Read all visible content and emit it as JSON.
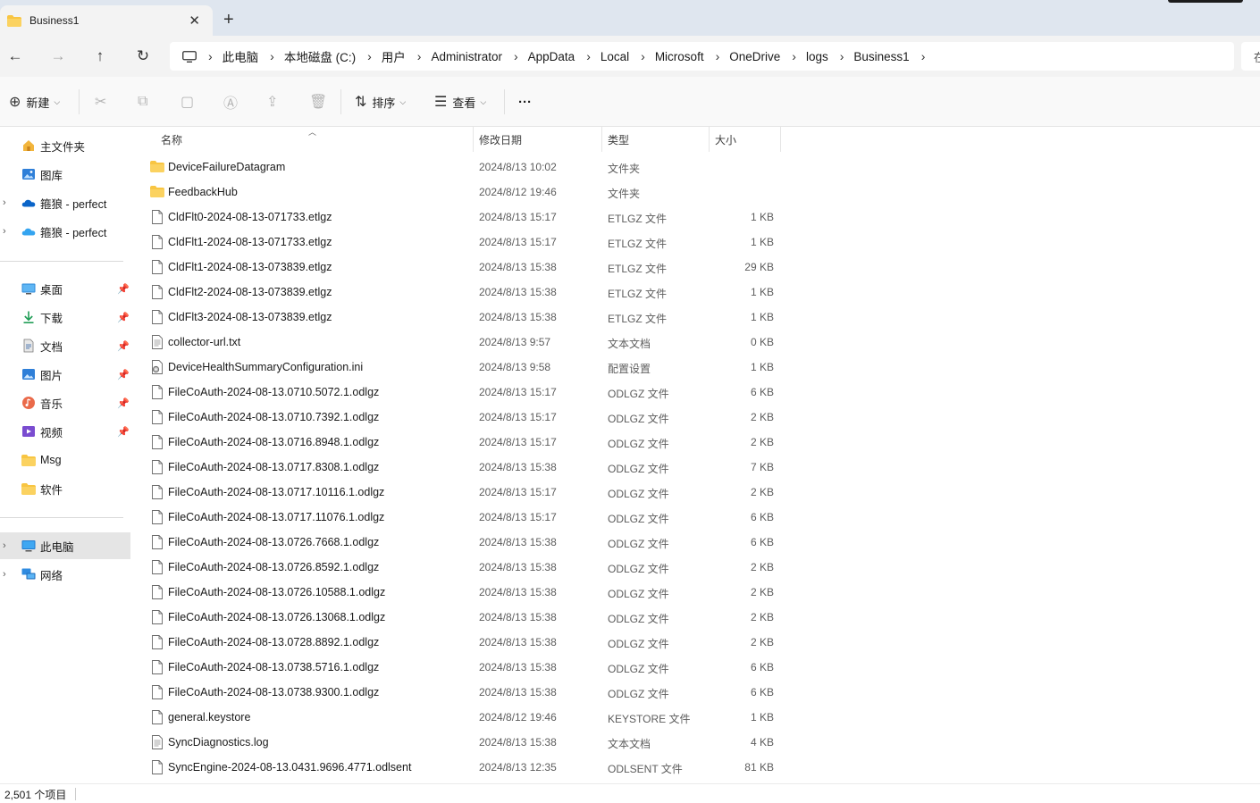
{
  "window": {
    "tab_title": "Business1",
    "tab_close": "✕",
    "new_tab": "+"
  },
  "nav": {
    "back": "←",
    "forward": "→",
    "up": "↑",
    "refresh": "↻",
    "breadcrumbs": [
      "此电脑",
      "本地磁盘 (C:)",
      "用户",
      "Administrator",
      "AppData",
      "Local",
      "Microsoft",
      "OneDrive",
      "logs",
      "Business1"
    ],
    "separator": "›",
    "search_placeholder": "在"
  },
  "commands": {
    "new_label": "新建",
    "sort_label": "排序",
    "view_label": "查看",
    "more_label": "···"
  },
  "sidebar": {
    "top_items": [
      {
        "label": "主文件夹",
        "icon": "home-icon"
      },
      {
        "label": "图库",
        "icon": "gallery-icon"
      },
      {
        "label": "箍狼 - perfect",
        "icon": "onedrive-icon"
      },
      {
        "label": "箍狼 - perfect",
        "icon": "onedrive-personal-icon"
      }
    ],
    "quick_access": [
      {
        "label": "桌面",
        "icon": "desktop-icon"
      },
      {
        "label": "下载",
        "icon": "download-icon"
      },
      {
        "label": "文档",
        "icon": "document-icon"
      },
      {
        "label": "图片",
        "icon": "pictures-icon"
      },
      {
        "label": "音乐",
        "icon": "music-icon"
      },
      {
        "label": "视频",
        "icon": "video-icon"
      },
      {
        "label": "Msg",
        "icon": "folder-icon"
      },
      {
        "label": "软件",
        "icon": "folder-icon"
      }
    ],
    "bottom_items": [
      {
        "label": "此电脑",
        "icon": "pc-icon"
      },
      {
        "label": "网络",
        "icon": "network-icon"
      }
    ]
  },
  "columns": {
    "name": "名称",
    "date": "修改日期",
    "type": "类型",
    "size": "大小"
  },
  "files": [
    {
      "name": "DeviceFailureDatagram",
      "date": "2024/8/13 10:02",
      "type": "文件夹",
      "size": "",
      "kind": "folder"
    },
    {
      "name": "FeedbackHub",
      "date": "2024/8/12 19:46",
      "type": "文件夹",
      "size": "",
      "kind": "folder"
    },
    {
      "name": "CldFlt0-2024-08-13-071733.etlgz",
      "date": "2024/8/13 15:17",
      "type": "ETLGZ 文件",
      "size": "1 KB",
      "kind": "file"
    },
    {
      "name": "CldFlt1-2024-08-13-071733.etlgz",
      "date": "2024/8/13 15:17",
      "type": "ETLGZ 文件",
      "size": "1 KB",
      "kind": "file"
    },
    {
      "name": "CldFlt1-2024-08-13-073839.etlgz",
      "date": "2024/8/13 15:38",
      "type": "ETLGZ 文件",
      "size": "29 KB",
      "kind": "file"
    },
    {
      "name": "CldFlt2-2024-08-13-073839.etlgz",
      "date": "2024/8/13 15:38",
      "type": "ETLGZ 文件",
      "size": "1 KB",
      "kind": "file"
    },
    {
      "name": "CldFlt3-2024-08-13-073839.etlgz",
      "date": "2024/8/13 15:38",
      "type": "ETLGZ 文件",
      "size": "1 KB",
      "kind": "file"
    },
    {
      "name": "collector-url.txt",
      "date": "2024/8/13 9:57",
      "type": "文本文档",
      "size": "0 KB",
      "kind": "text"
    },
    {
      "name": "DeviceHealthSummaryConfiguration.ini",
      "date": "2024/8/13 9:58",
      "type": "配置设置",
      "size": "1 KB",
      "kind": "config"
    },
    {
      "name": "FileCoAuth-2024-08-13.0710.5072.1.odlgz",
      "date": "2024/8/13 15:17",
      "type": "ODLGZ 文件",
      "size": "6 KB",
      "kind": "file"
    },
    {
      "name": "FileCoAuth-2024-08-13.0710.7392.1.odlgz",
      "date": "2024/8/13 15:17",
      "type": "ODLGZ 文件",
      "size": "2 KB",
      "kind": "file"
    },
    {
      "name": "FileCoAuth-2024-08-13.0716.8948.1.odlgz",
      "date": "2024/8/13 15:17",
      "type": "ODLGZ 文件",
      "size": "2 KB",
      "kind": "file"
    },
    {
      "name": "FileCoAuth-2024-08-13.0717.8308.1.odlgz",
      "date": "2024/8/13 15:38",
      "type": "ODLGZ 文件",
      "size": "7 KB",
      "kind": "file"
    },
    {
      "name": "FileCoAuth-2024-08-13.0717.10116.1.odlgz",
      "date": "2024/8/13 15:17",
      "type": "ODLGZ 文件",
      "size": "2 KB",
      "kind": "file"
    },
    {
      "name": "FileCoAuth-2024-08-13.0717.11076.1.odlgz",
      "date": "2024/8/13 15:17",
      "type": "ODLGZ 文件",
      "size": "6 KB",
      "kind": "file"
    },
    {
      "name": "FileCoAuth-2024-08-13.0726.7668.1.odlgz",
      "date": "2024/8/13 15:38",
      "type": "ODLGZ 文件",
      "size": "6 KB",
      "kind": "file"
    },
    {
      "name": "FileCoAuth-2024-08-13.0726.8592.1.odlgz",
      "date": "2024/8/13 15:38",
      "type": "ODLGZ 文件",
      "size": "2 KB",
      "kind": "file"
    },
    {
      "name": "FileCoAuth-2024-08-13.0726.10588.1.odlgz",
      "date": "2024/8/13 15:38",
      "type": "ODLGZ 文件",
      "size": "2 KB",
      "kind": "file"
    },
    {
      "name": "FileCoAuth-2024-08-13.0726.13068.1.odlgz",
      "date": "2024/8/13 15:38",
      "type": "ODLGZ 文件",
      "size": "2 KB",
      "kind": "file"
    },
    {
      "name": "FileCoAuth-2024-08-13.0728.8892.1.odlgz",
      "date": "2024/8/13 15:38",
      "type": "ODLGZ 文件",
      "size": "2 KB",
      "kind": "file"
    },
    {
      "name": "FileCoAuth-2024-08-13.0738.5716.1.odlgz",
      "date": "2024/8/13 15:38",
      "type": "ODLGZ 文件",
      "size": "6 KB",
      "kind": "file"
    },
    {
      "name": "FileCoAuth-2024-08-13.0738.9300.1.odlgz",
      "date": "2024/8/13 15:38",
      "type": "ODLGZ 文件",
      "size": "6 KB",
      "kind": "file"
    },
    {
      "name": "general.keystore",
      "date": "2024/8/12 19:46",
      "type": "KEYSTORE 文件",
      "size": "1 KB",
      "kind": "file"
    },
    {
      "name": "SyncDiagnostics.log",
      "date": "2024/8/13 15:38",
      "type": "文本文档",
      "size": "4 KB",
      "kind": "text"
    },
    {
      "name": "SyncEngine-2024-08-13.0431.9696.4771.odlsent",
      "date": "2024/8/13 12:35",
      "type": "ODLSENT 文件",
      "size": "81 KB",
      "kind": "file"
    }
  ],
  "status": {
    "item_count": "2,501 个项目"
  },
  "colors": {
    "folder": "#f8c542",
    "accent": "#0067c0",
    "tabbar_bg": "#dfe6ef",
    "selected_bg": "#e5e5e5"
  }
}
